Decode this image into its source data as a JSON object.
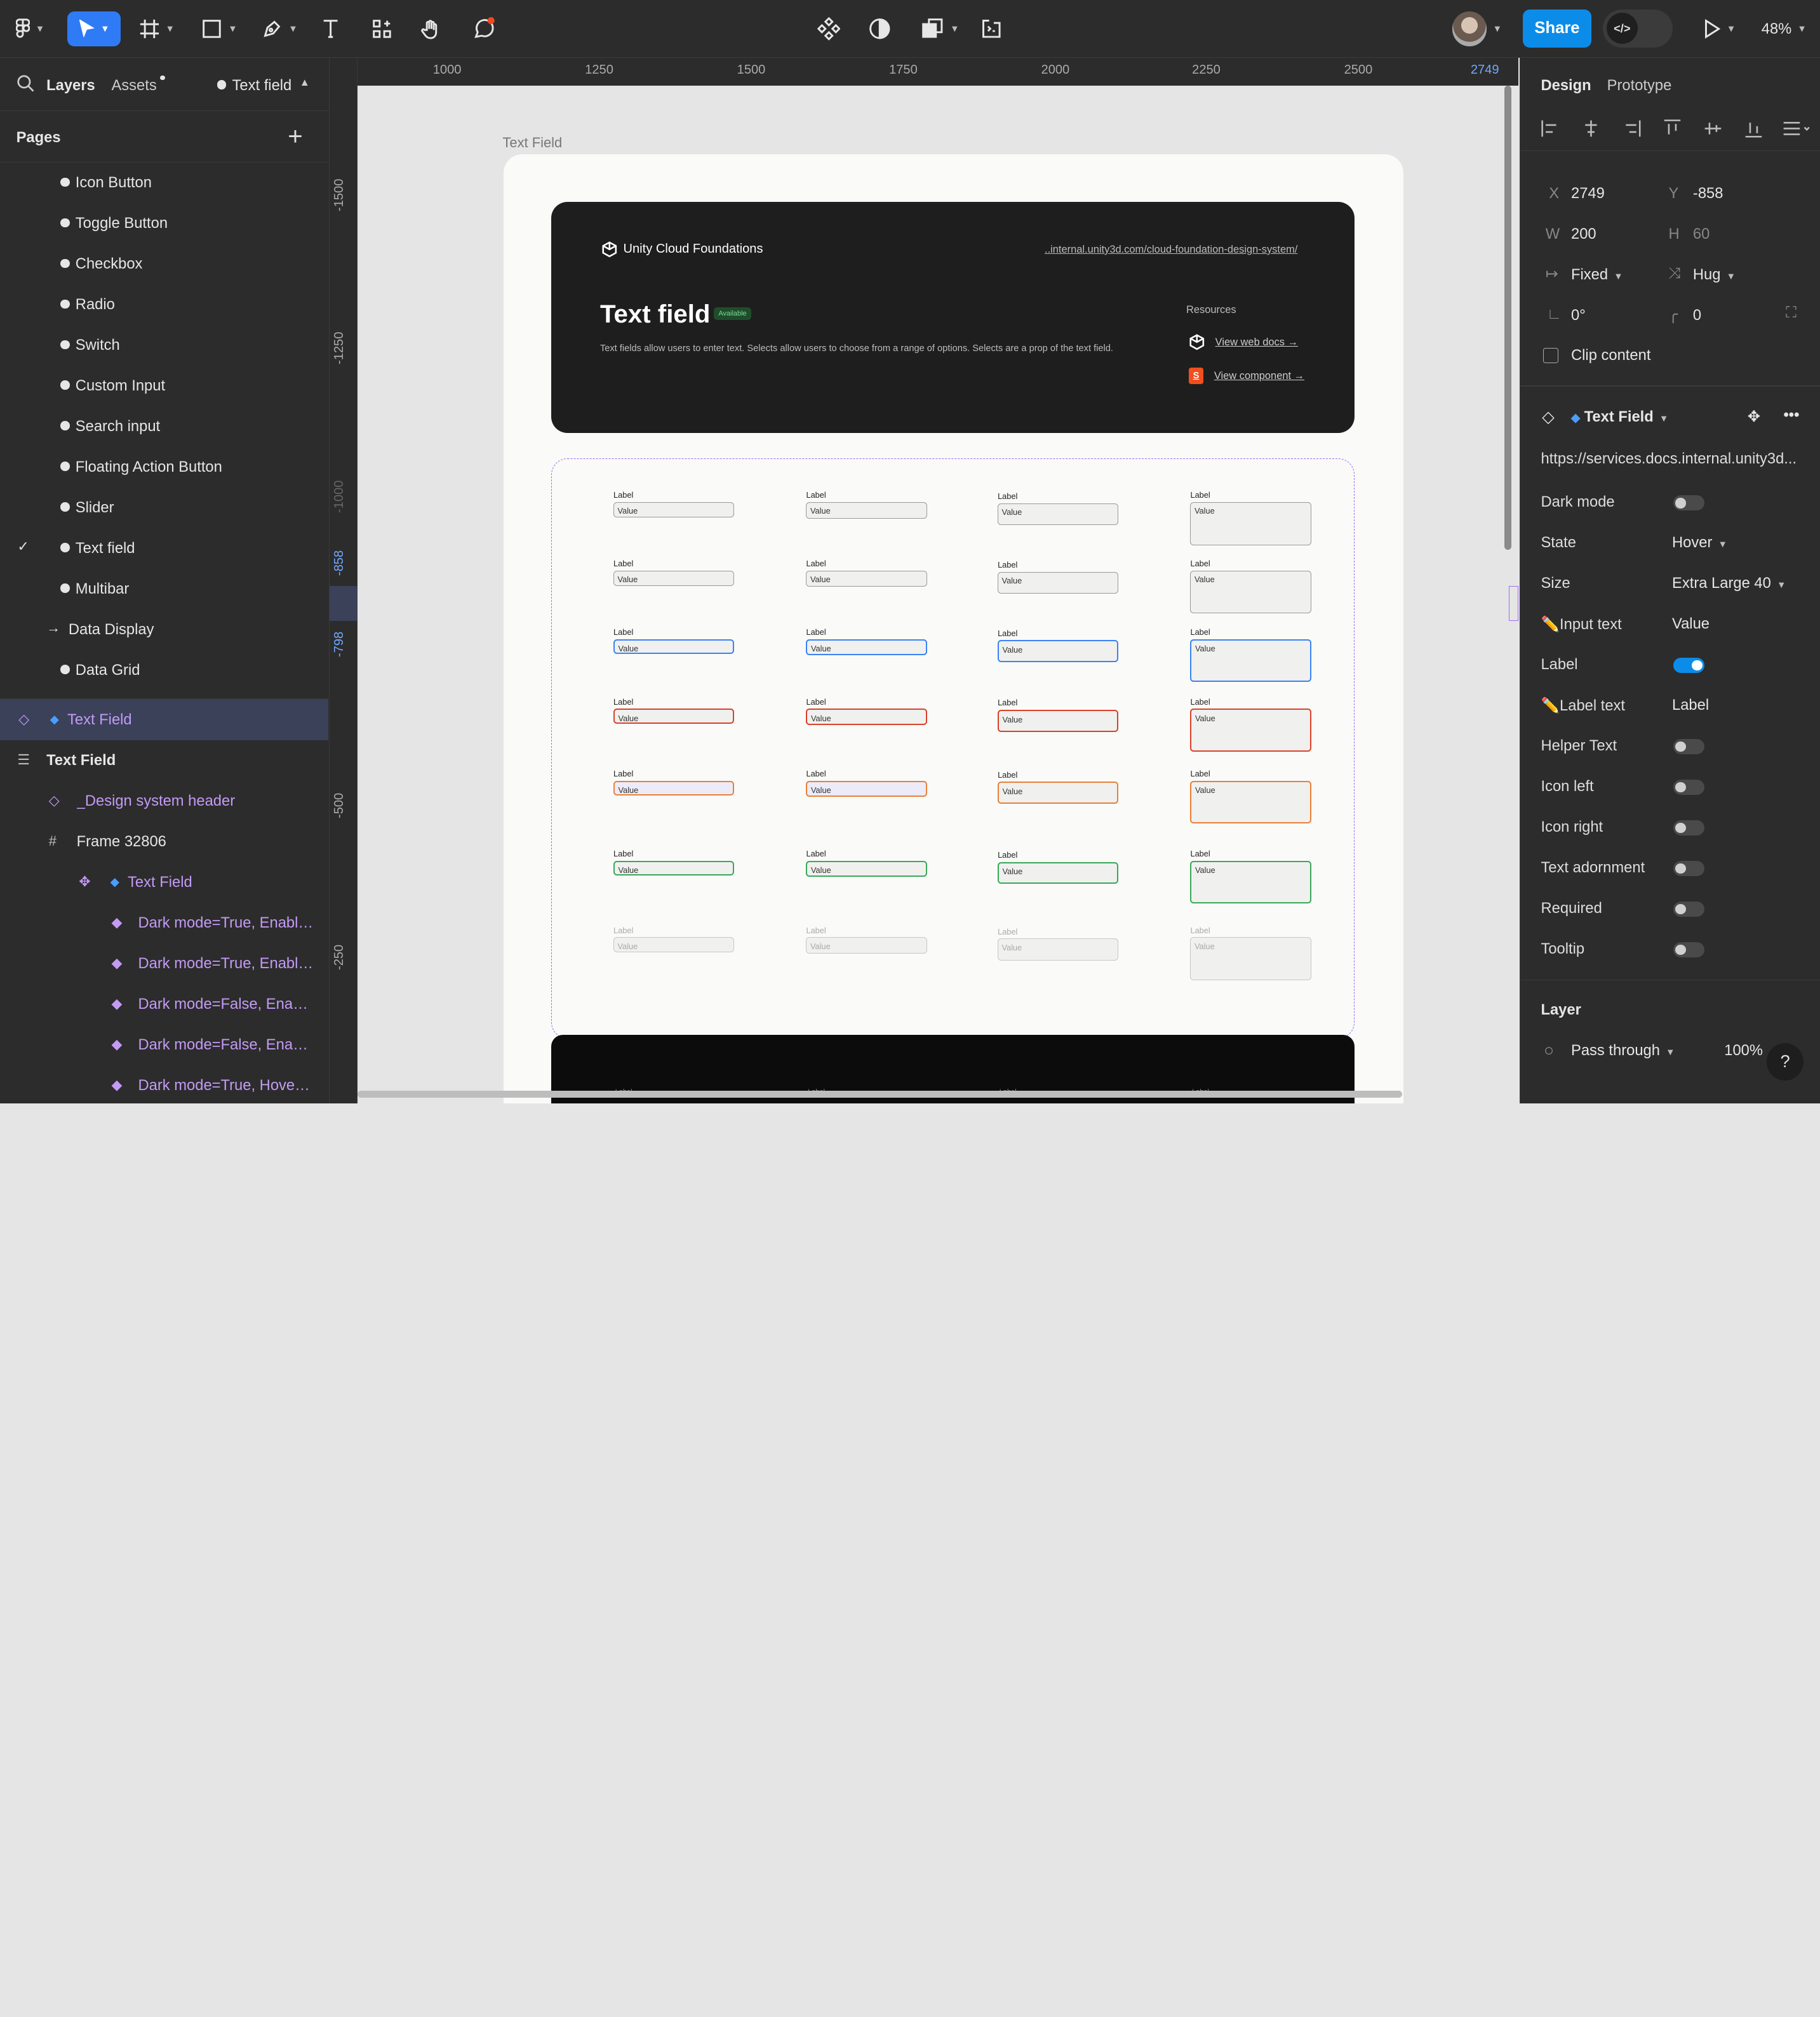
{
  "toolbar": {
    "share_label": "Share",
    "zoom_label": "48%",
    "icons": [
      "figma-menu-icon",
      "move-tool-icon",
      "frame-tool-icon",
      "shape-tool-icon",
      "pen-tool-icon",
      "text-tool-icon",
      "resources-icon",
      "hand-tool-icon",
      "comment-icon",
      "component-icon",
      "contrast-icon",
      "boolean-icon",
      "crop-icon",
      "dev-mode-icon",
      "play-icon"
    ]
  },
  "left_panel": {
    "tabs": {
      "layers": "Layers",
      "assets": "Assets",
      "current_page": "Text field"
    },
    "pages_title": "Pages",
    "pages": [
      "Icon Button",
      "Toggle Button",
      "Checkbox",
      "Radio",
      "Switch",
      "Custom Input",
      "Search input",
      "Floating Action Button",
      "Slider",
      "Text field",
      "Multibar",
      "Data Display",
      "Data Grid"
    ],
    "layers": [
      "Text Field",
      "Text Field",
      "_Design system header",
      "Frame 32806",
      "Text Field",
      "Dark mode=True, Enable...",
      "Dark mode=True, Enable...",
      "Dark mode=False, Enabl...",
      "Dark mode=False, Enabl...",
      "Dark mode=True, Hover, ..."
    ]
  },
  "canvas": {
    "ruler_top": [
      "1000",
      "1250",
      "1500",
      "1750",
      "2000",
      "2250",
      "2500",
      "2749"
    ],
    "ruler_left": [
      "-1500",
      "-1250",
      "-1000",
      "-858",
      "-798",
      "-500",
      "-250"
    ],
    "frame_title": "Text Field",
    "hero": {
      "brand": "Unity Cloud Foundations",
      "link": "..internal.unity3d.com/cloud-foundation-design-system/",
      "title": "Text field",
      "badge": "Available",
      "description": "Text fields allow users to enter text. Selects allow users to choose from a range of options. Selects are a prop of the text field.",
      "resources_title": "Resources",
      "resource_1": "View web docs →",
      "resource_2": "View component →"
    },
    "field_label": "Label",
    "field_value": "Value",
    "row_colors": [
      "#9a9a9a",
      "#9a9a9a",
      "#3b82f6",
      "#d9412b",
      "#e8813a",
      "#39a85a",
      "#c7c7c7"
    ]
  },
  "right_panel": {
    "tabs": {
      "design": "Design",
      "prototype": "Prototype"
    },
    "x_label": "X",
    "x": "2749",
    "y_label": "Y",
    "y": "-858",
    "w_label": "W",
    "w": "200",
    "h_label": "H",
    "h": "60",
    "width_mode": "Fixed",
    "height_mode": "Hug",
    "rotation": "0°",
    "radius": "0",
    "clip_content": "Clip content",
    "component_name": "Text Field",
    "component_url": "https://services.docs.internal.unity3d...",
    "props": [
      {
        "name": "Dark mode",
        "type": "toggle",
        "on": false
      },
      {
        "name": "State",
        "type": "select",
        "value": "Hover"
      },
      {
        "name": "Size",
        "type": "select",
        "value": "Extra Large 40"
      },
      {
        "name": "✏️Input text",
        "type": "text",
        "value": "Value"
      },
      {
        "name": "Label",
        "type": "toggle",
        "on": true
      },
      {
        "name": "✏️Label text",
        "type": "text",
        "value": "Label"
      },
      {
        "name": "Helper Text",
        "type": "toggle",
        "on": false
      },
      {
        "name": "Icon left",
        "type": "toggle",
        "on": false
      },
      {
        "name": "Icon right",
        "type": "toggle",
        "on": false
      },
      {
        "name": "Text adornment",
        "type": "toggle",
        "on": false
      },
      {
        "name": "Required",
        "type": "toggle",
        "on": false
      },
      {
        "name": "Tooltip",
        "type": "toggle",
        "on": false
      }
    ],
    "layer_title": "Layer",
    "blend_mode": "Pass through",
    "opacity": "100%",
    "help": "?"
  }
}
